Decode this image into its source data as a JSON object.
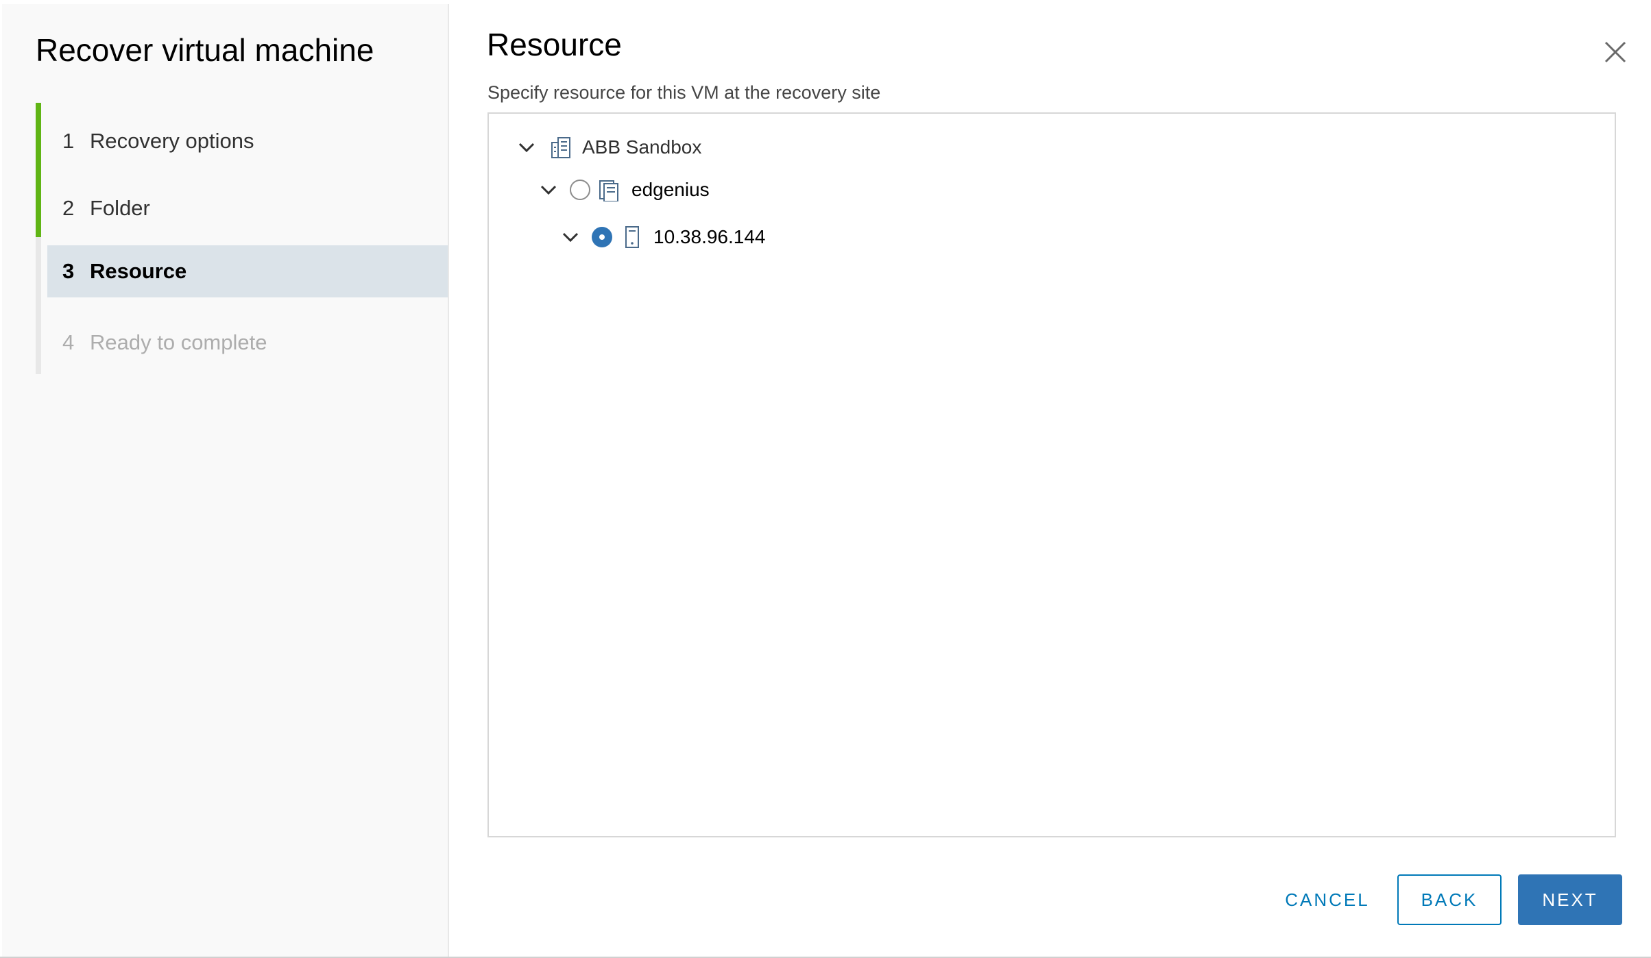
{
  "dialog": {
    "wizard_title": "Recover virtual machine",
    "steps": [
      {
        "num": "1",
        "label": "Recovery options",
        "state": "done"
      },
      {
        "num": "2",
        "label": "Folder",
        "state": "done"
      },
      {
        "num": "3",
        "label": "Resource",
        "state": "active"
      },
      {
        "num": "4",
        "label": "Ready to complete",
        "state": "disabled"
      }
    ],
    "page_title": "Resource",
    "subtitle": "Specify resource for this VM at the recovery site",
    "tree": [
      {
        "label": "ABB Sandbox",
        "icon": "datacenter-icon",
        "expanded": true,
        "selectable": false
      },
      {
        "label": "edgenius",
        "icon": "cluster-icon",
        "expanded": true,
        "selectable": true,
        "selected": false
      },
      {
        "label": "10.38.96.144",
        "icon": "host-icon",
        "expanded": true,
        "selectable": true,
        "selected": true
      }
    ],
    "buttons": {
      "cancel": "CANCEL",
      "back": "BACK",
      "next": "NEXT"
    },
    "colors": {
      "accent": "#2f74b5",
      "step_done": "#60b515",
      "active_step_bg": "#dbe3e9"
    }
  }
}
